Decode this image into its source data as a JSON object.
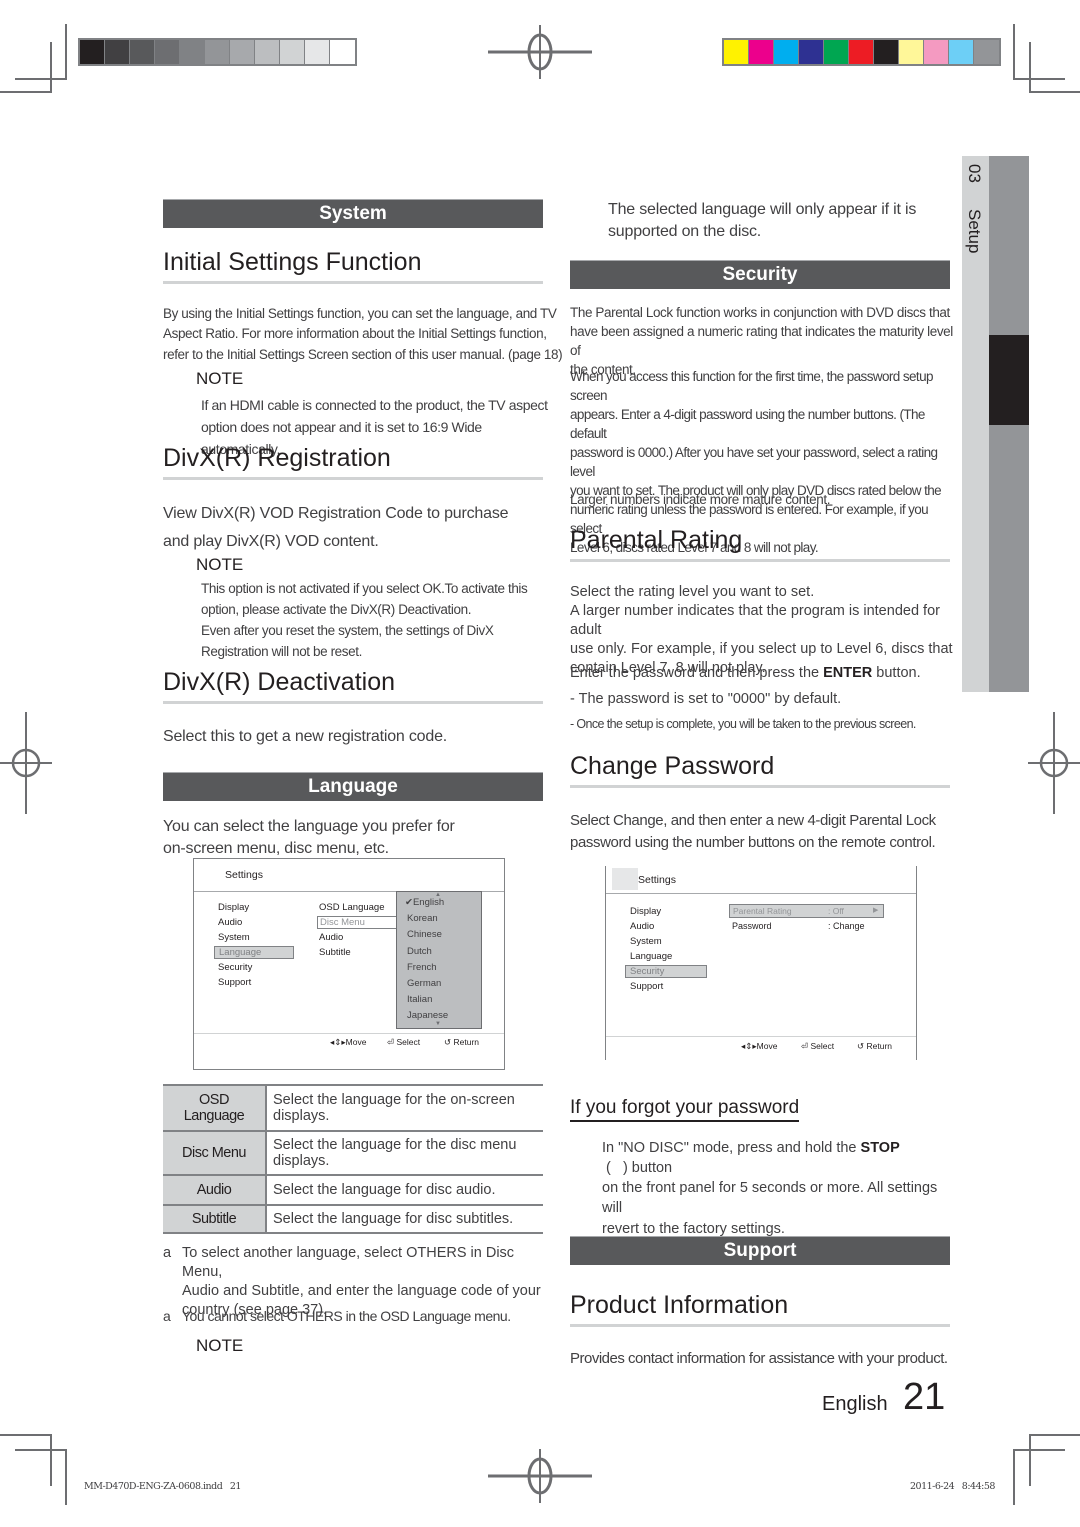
{
  "print_marks": {
    "grayscale_swatches": [
      "#231f20",
      "#414042",
      "#58595b",
      "#6d6e71",
      "#808285",
      "#939598",
      "#a7a9ac",
      "#bcbec0",
      "#d1d3d4",
      "#e6e7e8",
      "#ffffff"
    ],
    "color_swatches": [
      "#fff200",
      "#ec008c",
      "#00aeef",
      "#2e3192",
      "#00a651",
      "#ed1c24",
      "#231f20",
      "#fff799",
      "#f49ac1",
      "#6dcff6",
      "#939598"
    ],
    "slug_left": "MM-D470D-ENG-ZA-0608.indd   21",
    "slug_right": "2011-6-24   8:44:58"
  },
  "side_tab": {
    "chapter_number": "03",
    "chapter_title": "Setup"
  },
  "left_column": {
    "system_banner": "System",
    "initial_settings": {
      "heading": "Initial Settings Function",
      "body_lines": [
        "By using the Initial Settings function, you can set the language, and TV",
        "Aspect Ratio. For more information about the Initial Settings function,",
        "refer to the Initial Settings Screen section of this user manual. (page 18)"
      ],
      "note_label": "NOTE",
      "note_lines": [
        "If an HDMI cable is connected to the product, the TV aspect",
        "option does not appear and it is set to 16:9 Wide automatically."
      ]
    },
    "divx_registration": {
      "heading": "DivX(R) Registration",
      "body_lines": [
        "View DivX(R) VOD Registration Code to purchase",
        "and play DivX(R) VOD content."
      ],
      "note_label": "NOTE",
      "note_lines": [
        "This option is not activated if you select OK.To activate this",
        "option, please activate the DivX(R) Deactivation.",
        "Even after you reset the system, the settings of DivX",
        "Registration will not be reset."
      ]
    },
    "divx_deactivation": {
      "heading": "DivX(R) Deactivation",
      "body": "Select this to get a new registration code."
    },
    "language_banner": "Language",
    "language_intro_lines": [
      "You can select the language you prefer for",
      "on-screen menu, disc menu, etc."
    ],
    "language_screen": {
      "title": "Settings",
      "menu": [
        "Display",
        "Audio",
        "System",
        "Language",
        "Security",
        "Support"
      ],
      "selected_menu": "Language",
      "submenu": [
        "OSD Language",
        "Disc Menu",
        "Audio",
        "Subtitle"
      ],
      "selected_submenu": "Disc Menu",
      "languages": [
        "English",
        "Korean",
        "Chinese",
        "Dutch",
        "French",
        "German",
        "Italian",
        "Japanese"
      ],
      "checked_language": "English",
      "hints": {
        "move": "Move",
        "select": "Select",
        "return": "Return"
      }
    },
    "language_table": [
      {
        "key": "OSD Language",
        "desc_lines": [
          "Select the language for the on-screen",
          "displays."
        ]
      },
      {
        "key": "Disc Menu",
        "desc_lines": [
          "Select the language for the disc menu",
          "displays."
        ]
      },
      {
        "key": "Audio",
        "desc_lines": [
          "Select the language for disc audio."
        ]
      },
      {
        "key": "Subtitle",
        "desc_lines": [
          "Select the language for disc subtitles."
        ]
      }
    ],
    "bullets": [
      {
        "marker": "a",
        "lines": [
          "To select another language, select OTHERS in Disc Menu,",
          "Audio and Subtitle, and enter the language code of your",
          "country (see page 37)."
        ]
      },
      {
        "marker": "a",
        "lines": [
          "You cannot select OTHERS in the OSD Language menu."
        ]
      }
    ],
    "final_note_label": "NOTE"
  },
  "right_column": {
    "language_note_lines": [
      "The selected language will only appear if it is",
      "supported on the disc."
    ],
    "security_banner": "Security",
    "security_intro_lines": [
      "The Parental Lock function works in conjunction with DVD discs that",
      "have been assigned a numeric rating that indicates the maturity level of",
      "the content."
    ],
    "security_detail_lines": [
      "When you access this function for the first time, the password setup screen",
      "appears. Enter a 4-digit password using the number buttons. (The default",
      "password is 0000.) After you have set your password, select a rating level",
      "you want to set. The product will only play DVD discs rated below the",
      "numeric rating unless the password is entered. For example, if you select",
      "Level 6, discs rated Level 7 and 8 will not play."
    ],
    "security_larger": "Larger numbers indicate more mature content.",
    "parental_rating": {
      "heading": "Parental Rating",
      "body_lines": [
        "Select the rating level you want to set.",
        "A larger number indicates that the program is intended for adult",
        "use only. For example, if you select up to Level 6, discs that",
        "contain Level 7, 8 will not play."
      ],
      "enter_prefix": "Enter the password and then press the ",
      "enter_bold": "ENTER",
      "enter_suffix": " button.",
      "dash1": "- The password is set to \"0000\" by default.",
      "dash2": "- Once the setup is complete, you will be taken to the previous screen."
    },
    "change_password": {
      "heading": "Change Password",
      "body_lines": [
        "Select Change, and then enter a new 4-digit Parental Lock",
        "password using the number buttons on the remote control."
      ]
    },
    "security_screen": {
      "title": "Settings",
      "menu": [
        "Display",
        "Audio",
        "System",
        "Language",
        "Security",
        "Support"
      ],
      "selected_menu": "Security",
      "rows": [
        {
          "label": "Parental Rating",
          "value": ": Off"
        },
        {
          "label": "Password",
          "value": ": Change"
        }
      ],
      "hints": {
        "move": "Move",
        "select": "Select",
        "return": "Return"
      }
    },
    "forgot_password": {
      "heading": "If you forgot your password",
      "line1_prefix": "In \"NO DISC\" mode, press and hold the ",
      "line1_bold": "STOP",
      "line1_suffix": " (   ) button",
      "line2": "on the front panel for 5 seconds or more. All settings will",
      "line3": "revert to the factory settings."
    },
    "support_banner": "Support",
    "product_information": {
      "heading": "Product Information",
      "body": "Provides contact information for assistance with your product."
    },
    "footer": {
      "language": "English",
      "page_number": "21"
    }
  }
}
